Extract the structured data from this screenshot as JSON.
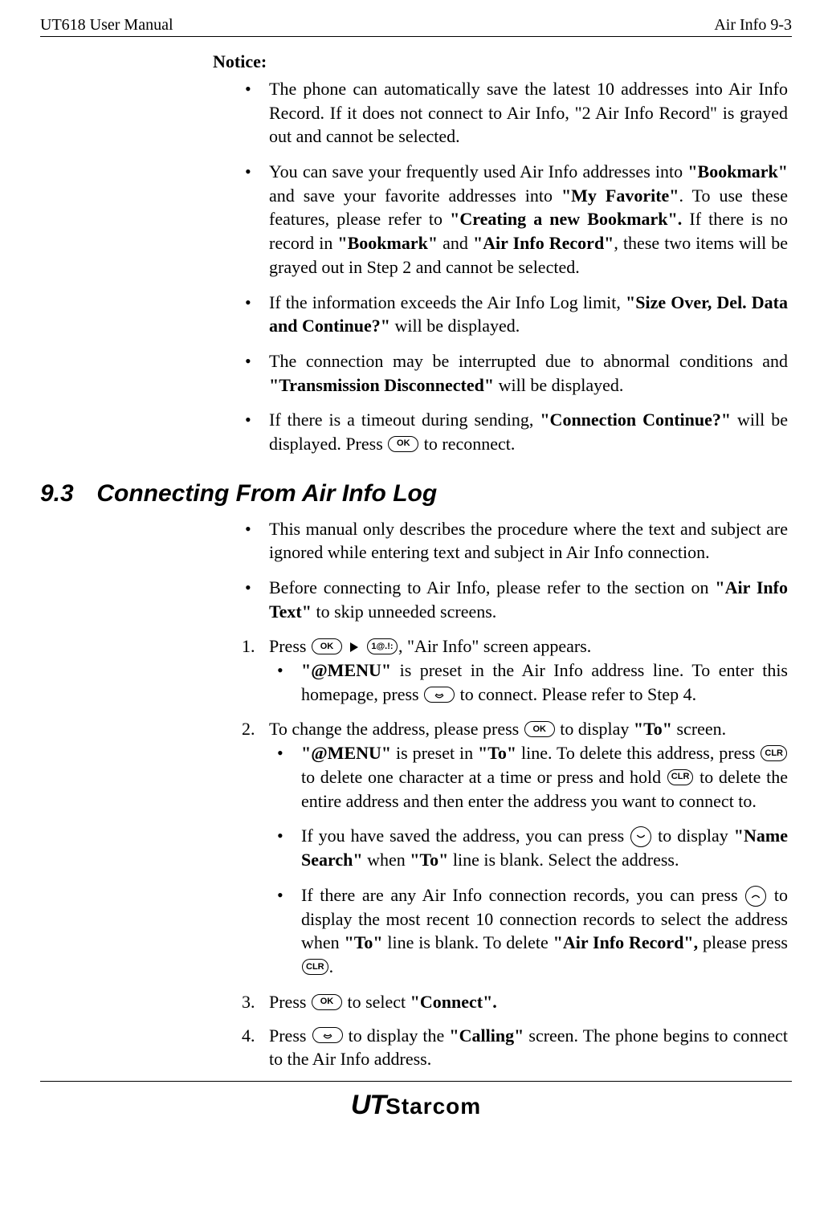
{
  "header": {
    "left": "UT618 User Manual",
    "right": "Air Info   9-3"
  },
  "notice": {
    "title": "Notice:",
    "items": [
      {
        "pre": "The phone can automatically save the latest 10 addresses into Air Info Record. If it does not connect to Air Info, \"2 Air Info Record\" is grayed out and cannot be selected."
      },
      {
        "pre": "You can save your frequently used Air Info addresses into ",
        "b1": "\"Bookmark\"",
        "mid1": " and save your favorite addresses into ",
        "b2": "\"My Favorite\"",
        "mid2": ". To use these features, please refer to ",
        "b3": "\"Creating a new Bookmark\".",
        "mid3": " If there is no record in ",
        "b4": "\"Bookmark\"",
        "mid4": " and ",
        "b5": "\"Air Info Record\"",
        "post": ", these two items will be grayed out in Step 2 and cannot be selected."
      },
      {
        "pre": "If the information exceeds the Air Info Log limit, ",
        "b1": "\"Size Over, Del. Data and Continue?\"",
        "post": " will be displayed."
      },
      {
        "pre": "The connection may be interrupted due to abnormal conditions and ",
        "b1": "\"Transmission Disconnected\"",
        "post": " will be displayed."
      },
      {
        "pre": "If there is a timeout during sending, ",
        "b1": "\"Connection Continue?\"",
        "mid1": " will be displayed. Press ",
        "btn1": "OK",
        "post": " to reconnect."
      }
    ]
  },
  "section": {
    "number": "9.3",
    "title": "Connecting From Air Info Log",
    "intro": [
      {
        "pre": "This manual only describes the procedure where the text and subject are ignored while entering text and subject in Air Info connection."
      },
      {
        "pre": "Before connecting to Air Info, please refer to the section on ",
        "b1": "\"Air Info Text\"",
        "post": " to skip unneeded screens."
      }
    ],
    "steps": {
      "s1": {
        "press": "Press ",
        "btn1": "OK",
        "btn2": "1@.!:",
        "after": ", \"Air Info\" screen appears.",
        "sub1": {
          "b1": "\"@MENU\"",
          "mid1": " is preset in the Air Info address line. To enter this homepage, press ",
          "post": " to connect. Please refer to Step 4."
        }
      },
      "s2": {
        "pre": "To change the address, please press ",
        "btn1": "OK",
        "mid1": " to display ",
        "b1": "\"To\"",
        "post": " screen.",
        "sub1": {
          "b1": "\"@MENU\"",
          "mid1": " is preset in ",
          "b2": "\"To\"",
          "mid2": " line. To delete this address, press ",
          "btn1": "CLR",
          "mid3": " to delete one character at a time or press and hold ",
          "btn2": "CLR",
          "post": " to delete the entire address and then enter the address you want to connect to."
        },
        "sub2": {
          "pre": "If you have saved the address, you can press ",
          "mid1": " to display ",
          "b1": "\"Name Search\"",
          "mid2": " when ",
          "b2": "\"To\"",
          "post": " line is blank. Select the address."
        },
        "sub3": {
          "pre": "If there are any Air Info connection records, you can press ",
          "mid1": " to display the most recent 10 connection records to select the address when ",
          "b1": "\"To\"",
          "mid2": " line is blank. To delete ",
          "b2": "\"Air Info Record\",",
          "mid3": " please press ",
          "btn1": "CLR",
          "post": "."
        }
      },
      "s3": {
        "press": "Press ",
        "btn1": "OK",
        "mid1": " to select ",
        "b1": "\"Connect\".",
        "post": ""
      },
      "s4": {
        "press": "Press ",
        "mid1": " to display the ",
        "b1": "\"Calling\"",
        "post": " screen. The phone begins to connect to the Air Info address."
      }
    }
  },
  "footer": {
    "logo1": "UT",
    "logo2": "Starcom"
  }
}
